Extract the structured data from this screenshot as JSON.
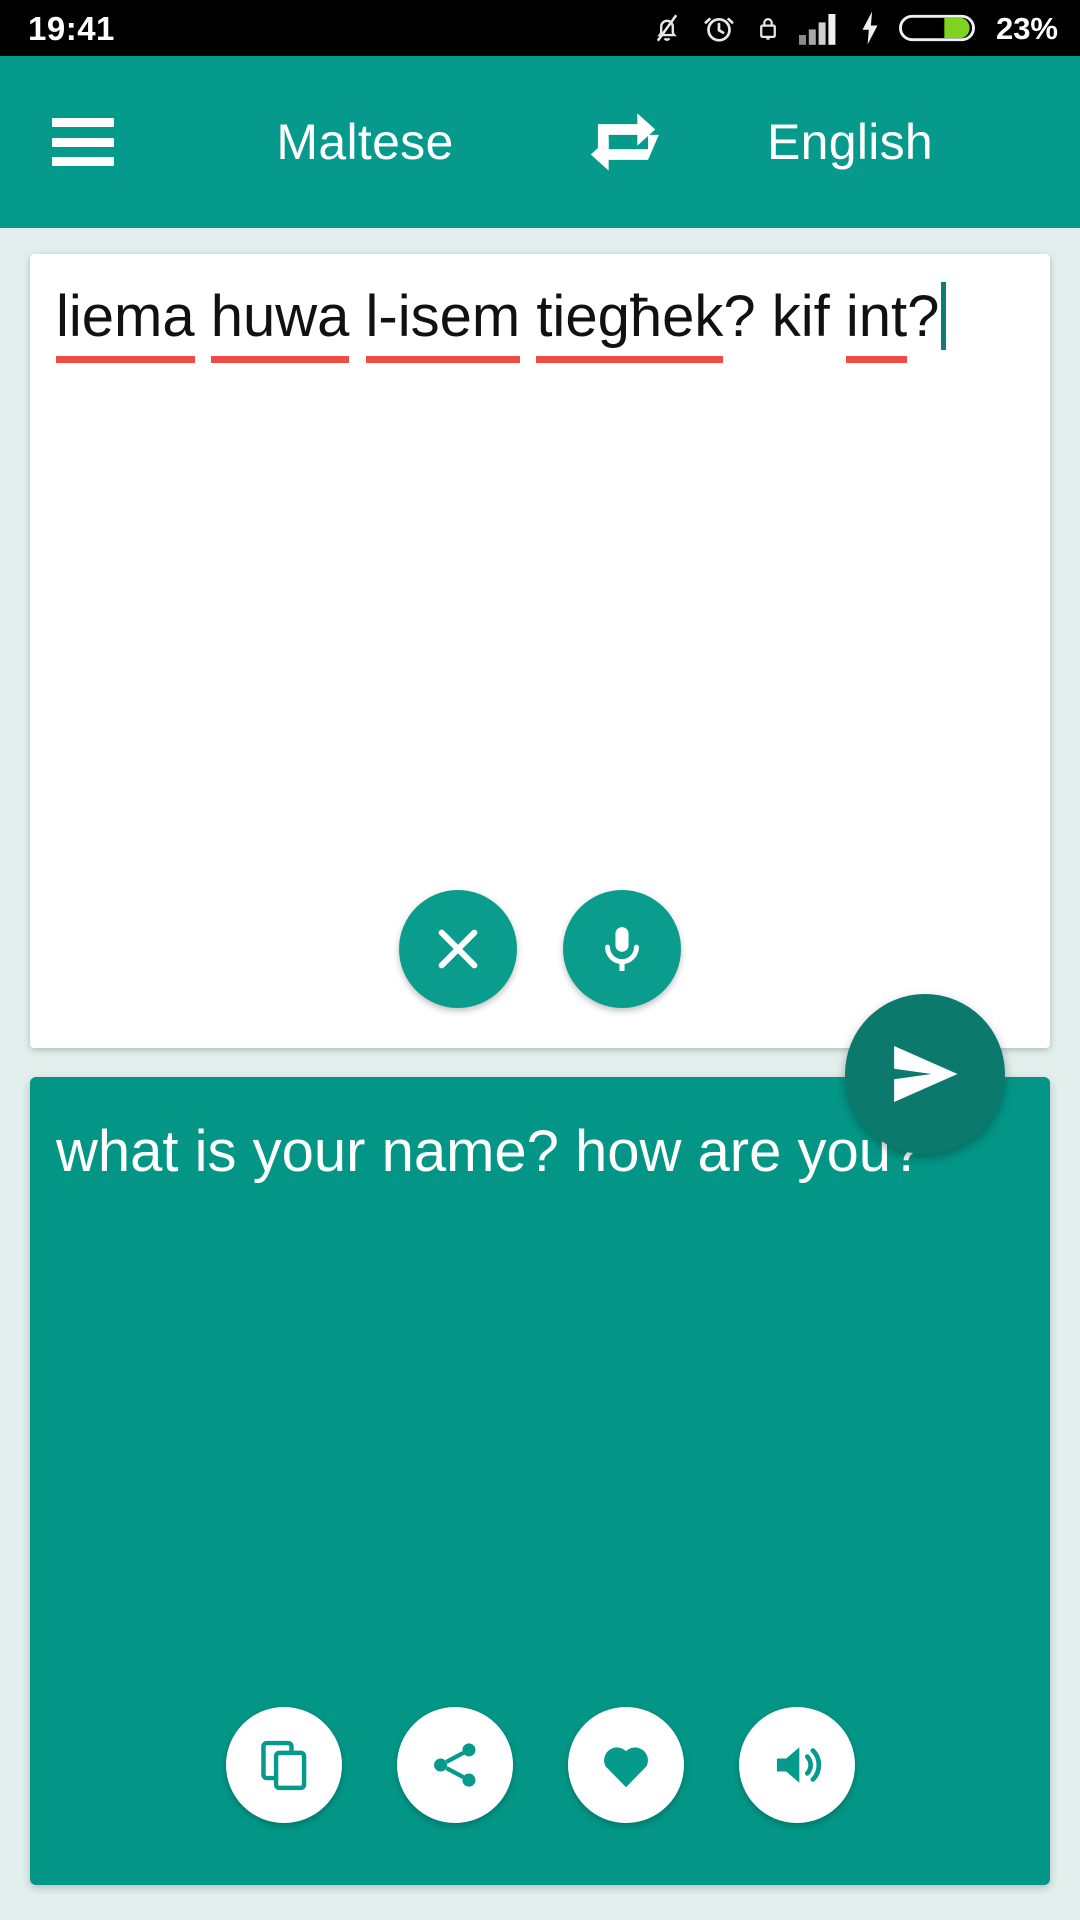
{
  "status_bar": {
    "time": "19:41",
    "battery_percent": "23%",
    "icons": [
      "notifications-off-icon",
      "alarm-icon",
      "lock-icon",
      "signal-icon",
      "charging-bolt-icon",
      "battery-icon"
    ],
    "battery_color": "#7ed321",
    "background": "#000000"
  },
  "app_bar": {
    "menu_label": "menu",
    "source_language": "Maltese",
    "swap_label": "swap-languages",
    "target_language": "English",
    "background": "#059a8c"
  },
  "input_card": {
    "text": "liema huwa l-isem tiegħek? kif int?",
    "tokens": [
      {
        "text": "liema",
        "misspelled": true
      },
      {
        "text": " ",
        "misspelled": false
      },
      {
        "text": "huwa",
        "misspelled": true
      },
      {
        "text": " ",
        "misspelled": false
      },
      {
        "text": "l-isem",
        "misspelled": true
      },
      {
        "text": " ",
        "misspelled": false
      },
      {
        "text": "tiegħek",
        "misspelled": true
      },
      {
        "text": "? ",
        "misspelled": false
      },
      {
        "text": "kif",
        "misspelled": false
      },
      {
        "text": " ",
        "misspelled": false
      },
      {
        "text": "int",
        "misspelled": true
      },
      {
        "text": "?",
        "misspelled": false
      }
    ],
    "spellcheck_color": "#ef4c44",
    "clear_label": "clear",
    "mic_label": "voice-input",
    "background": "#ffffff"
  },
  "send_button": {
    "label": "translate",
    "color": "#0b7a6d"
  },
  "output_card": {
    "text": "what is your name? how are you?",
    "background": "#039687",
    "actions": [
      {
        "name": "copy",
        "label": "copy"
      },
      {
        "name": "share",
        "label": "share"
      },
      {
        "name": "favorite",
        "label": "favorite"
      },
      {
        "name": "speak",
        "label": "listen"
      }
    ]
  },
  "theme": {
    "page_background": "#e2efec",
    "accent": "#039687"
  }
}
